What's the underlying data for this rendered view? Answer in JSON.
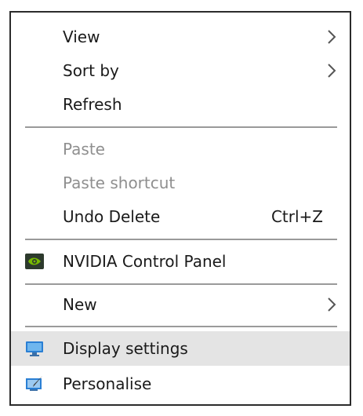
{
  "menu": {
    "items": [
      {
        "label": "View",
        "submenu": true
      },
      {
        "label": "Sort by",
        "submenu": true
      },
      {
        "label": "Refresh"
      },
      {
        "label": "Paste",
        "disabled": true
      },
      {
        "label": "Paste shortcut",
        "disabled": true
      },
      {
        "label": "Undo Delete",
        "shortcut": "Ctrl+Z"
      },
      {
        "label": "NVIDIA Control Panel",
        "icon": "nvidia-icon"
      },
      {
        "label": "New",
        "submenu": true
      },
      {
        "label": "Display settings",
        "icon": "display-icon",
        "highlighted": true
      },
      {
        "label": "Personalise",
        "icon": "personalise-icon"
      }
    ]
  },
  "colors": {
    "highlight": "#e4e4e4",
    "disabled_text": "#8f8f8f",
    "nvidia_green": "#76b900",
    "display_blue": "#2a7fd4"
  }
}
